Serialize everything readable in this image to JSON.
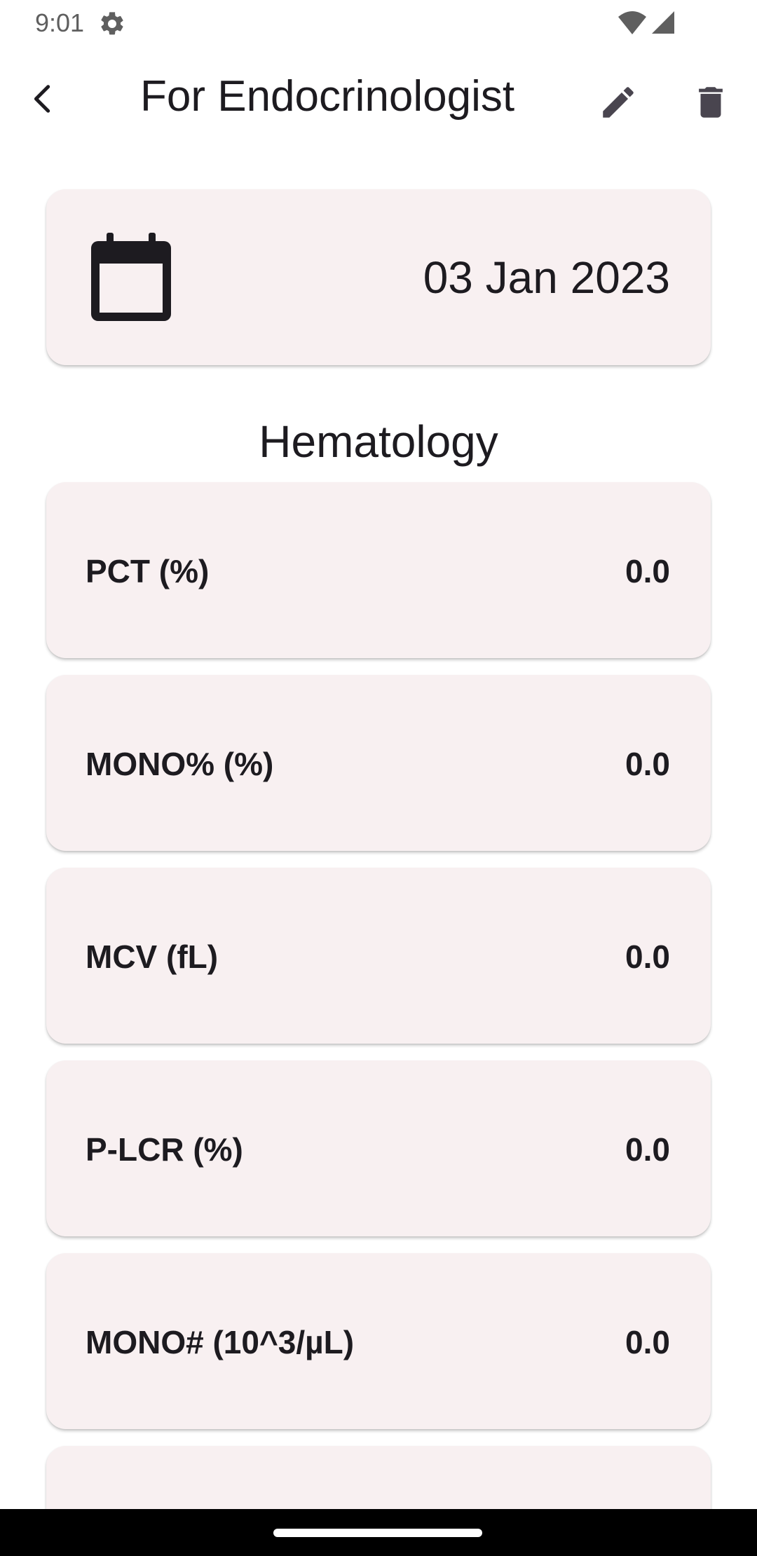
{
  "status_bar": {
    "time": "9:01",
    "icons": [
      "gear-icon",
      "wifi-icon",
      "signal-icon"
    ]
  },
  "app_bar": {
    "title": "For Endocrinologist",
    "icons": [
      "back-arrow-icon",
      "pencil-icon",
      "trash-icon"
    ]
  },
  "date_card": {
    "icon": "calendar-icon",
    "date": "03 Jan 2023"
  },
  "section": {
    "title": "Hematology"
  },
  "results": [
    {
      "label": "PCT (%)",
      "value": "0.0"
    },
    {
      "label": "MONO% (%)",
      "value": "0.0"
    },
    {
      "label": "MCV (fL)",
      "value": "0.0"
    },
    {
      "label": "P-LCR (%)",
      "value": "0.0"
    },
    {
      "label": "MONO# (10^3/µL)",
      "value": "0.0"
    }
  ],
  "colors": {
    "card_background": "#f8f0f1",
    "text": "#1d1b20",
    "icon": "#49454f",
    "nav_bar": "#000000"
  }
}
